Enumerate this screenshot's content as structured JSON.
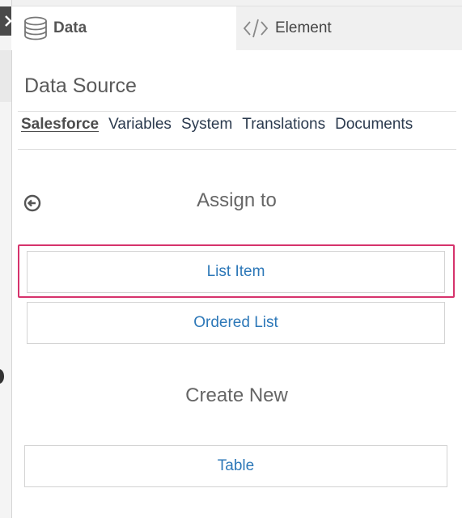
{
  "tabs": [
    {
      "label": "Data",
      "icon": "database-icon",
      "active": true
    },
    {
      "label": "Element",
      "icon": "code-icon",
      "active": false
    }
  ],
  "panel": {
    "title": "Data Source",
    "source_tabs": [
      {
        "label": "Salesforce",
        "active": true
      },
      {
        "label": "Variables",
        "active": false
      },
      {
        "label": "System",
        "active": false
      },
      {
        "label": "Translations",
        "active": false
      },
      {
        "label": "Documents",
        "active": false
      }
    ],
    "assign_heading": "Assign to",
    "assign_options": [
      "List Item",
      "Ordered List"
    ],
    "create_heading": "Create New",
    "create_options": [
      "Table"
    ]
  },
  "colors": {
    "accent_link": "#2d78b8",
    "highlight": "#d6336c",
    "heading": "#666666"
  }
}
